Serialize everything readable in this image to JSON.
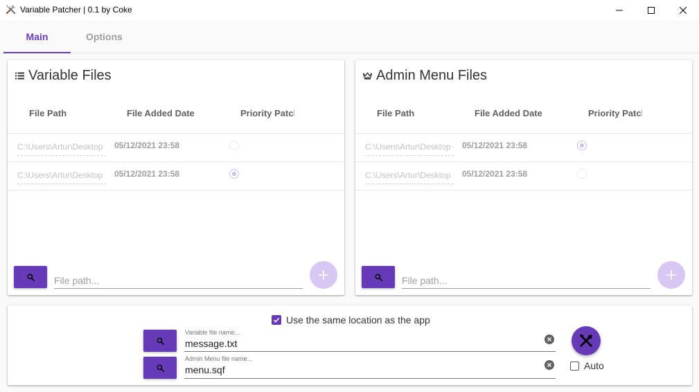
{
  "window": {
    "title": "Variable Patcher | 0.1 by Coke",
    "icon": "tools-icon",
    "controls": [
      "minimize-icon",
      "maximize-icon",
      "close-icon"
    ]
  },
  "tabs": [
    {
      "label": "Main",
      "active": true
    },
    {
      "label": "Options",
      "active": false
    }
  ],
  "accent_color": "#673ab7",
  "panels": {
    "variable": {
      "title": "Variable Files",
      "icon": "list-icon",
      "columns": [
        "File Path",
        "File Added Date",
        "Priority Patch"
      ],
      "rows": [
        {
          "path": "C:\\Users\\Artur\\Desktop",
          "date": "05/12/2021 23:58",
          "priority": false
        },
        {
          "path": "C:\\Users\\Artur\\Desktop",
          "date": "05/12/2021 23:58",
          "priority": true
        }
      ],
      "input_placeholder": "File path..."
    },
    "admin": {
      "title": "Admin Menu Files",
      "icon": "crown-icon",
      "columns": [
        "File Path",
        "File Added Date",
        "Priority Patch"
      ],
      "rows": [
        {
          "path": "C:\\Users\\Artur\\Desktop",
          "date": "05/12/2021 23:58",
          "priority": true
        },
        {
          "path": "C:\\Users\\Artur\\Desktop",
          "date": "05/12/2021 23:58",
          "priority": false
        }
      ],
      "input_placeholder": "File path..."
    }
  },
  "output": {
    "same_location_label": "Use the same location as the app",
    "same_location_checked": true,
    "variable_hint": "Variable file name...",
    "variable_value": "message.txt",
    "admin_hint": "Admin Menu file name...",
    "admin_value": "menu.sqf",
    "auto_label": "Auto",
    "auto_checked": false
  }
}
